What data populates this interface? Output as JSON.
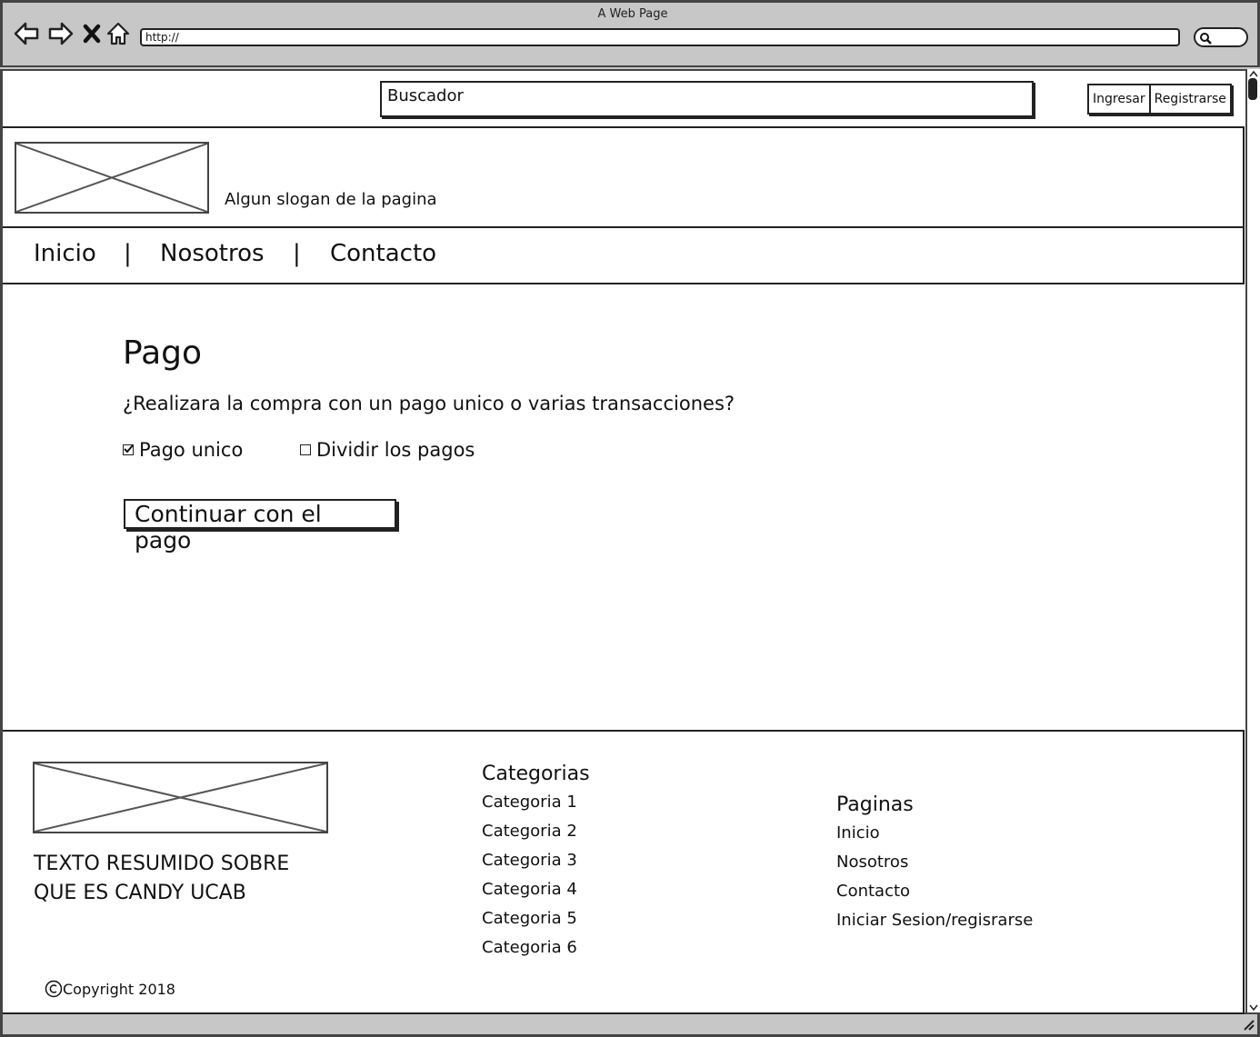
{
  "window": {
    "title": "A Web Page",
    "url": "http://"
  },
  "header": {
    "search_placeholder": "Buscador",
    "login_label": "Ingresar",
    "register_label": "Registrarse",
    "slogan": "Algun slogan de la pagina"
  },
  "nav": {
    "items": [
      "Inicio",
      "Nosotros",
      "Contacto"
    ],
    "separator": "|"
  },
  "main": {
    "title": "Pago",
    "question": "¿Realizara la compra con un pago unico o varias transacciones?",
    "options": [
      {
        "label": "Pago unico",
        "checked": true
      },
      {
        "label": "Dividir los pagos",
        "checked": false
      }
    ],
    "continue_button": "Continuar con el pago"
  },
  "footer": {
    "summary_line1": "TEXTO RESUMIDO SOBRE",
    "summary_line2": "QUE ES CANDY UCAB",
    "categories": {
      "title": "Categorias",
      "items": [
        "Categoria 1",
        "Categoria 2",
        "Categoria 3",
        "Categoria 4",
        "Categoria 5",
        "Categoria 6"
      ]
    },
    "pages": {
      "title": "Paginas",
      "items": [
        "Inicio",
        "Nosotros",
        "Contacto",
        "Iniciar Sesion/regisrarse"
      ]
    },
    "copyright": "Copyright 2018"
  }
}
